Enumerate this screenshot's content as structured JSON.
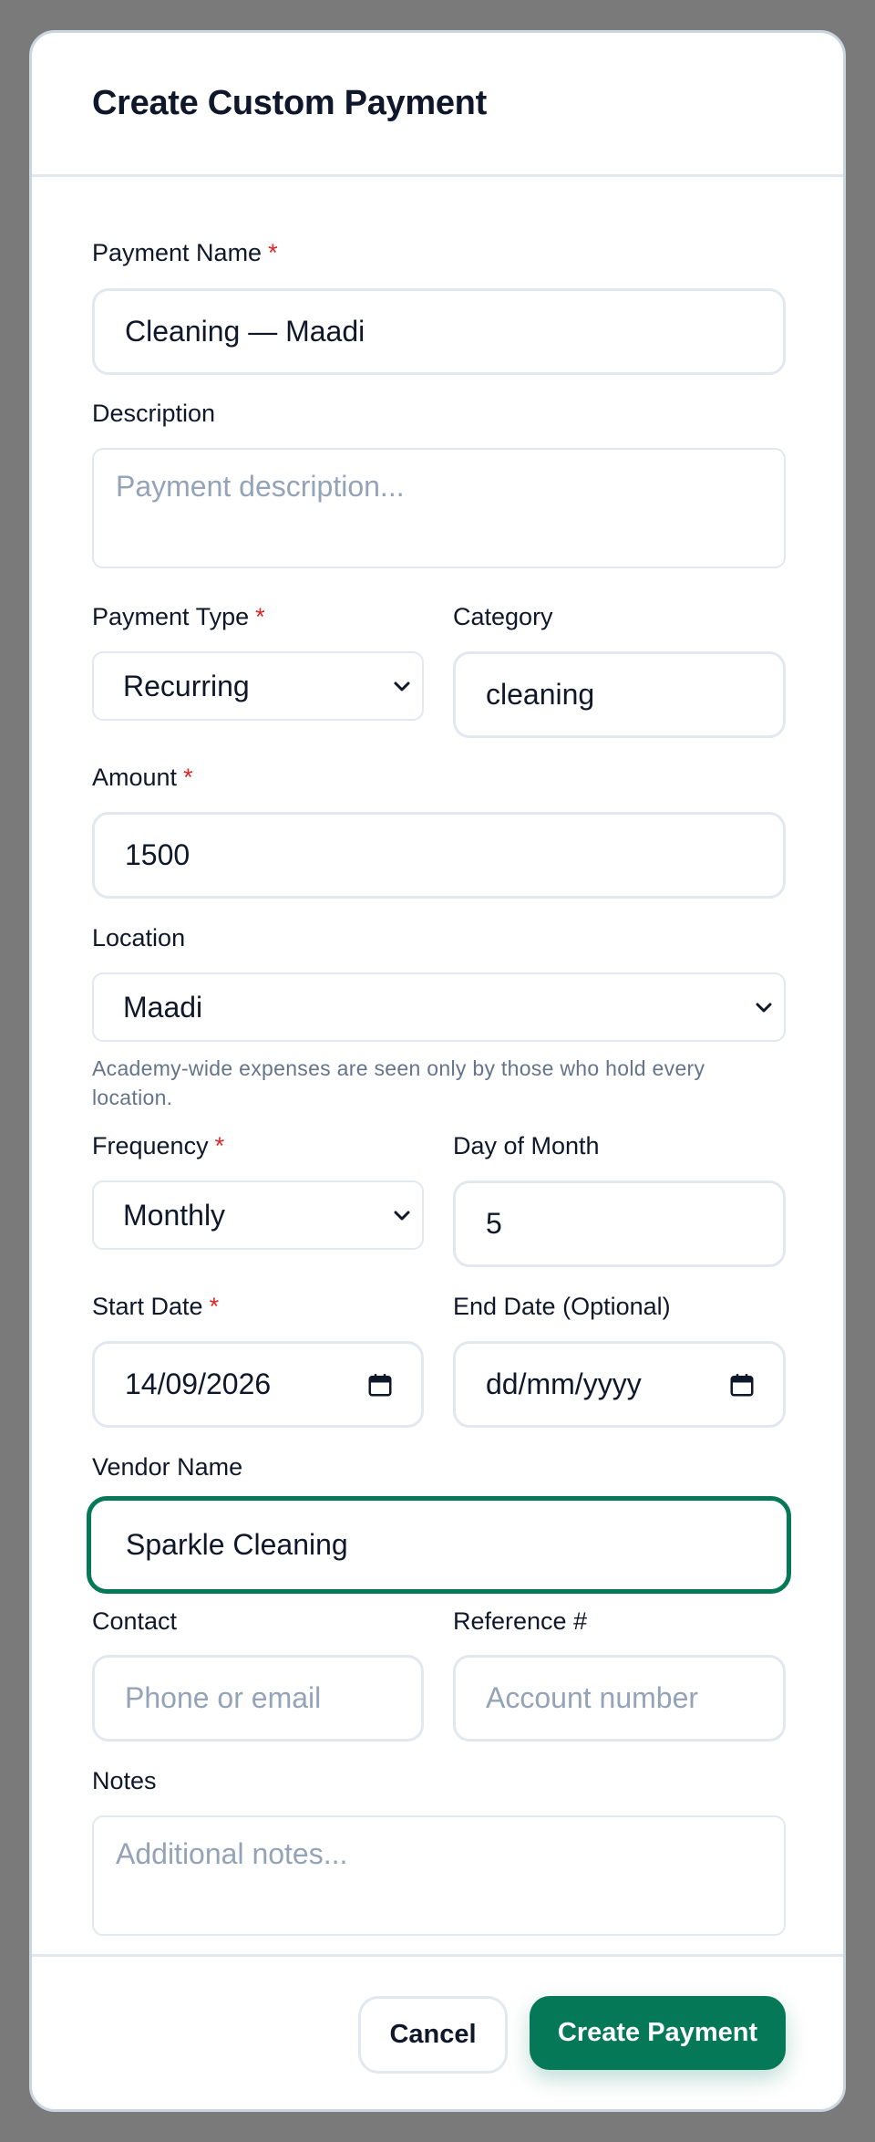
{
  "modal": {
    "title": "Create Custom Payment"
  },
  "form": {
    "required_mark": "*",
    "payment_name": {
      "label": "Payment Name",
      "value": "Cleaning — Maadi"
    },
    "description": {
      "label": "Description",
      "placeholder": "Payment description..."
    },
    "payment_type": {
      "label": "Payment Type",
      "value": "Recurring"
    },
    "category": {
      "label": "Category",
      "value": "cleaning"
    },
    "amount": {
      "label": "Amount",
      "value": "1500"
    },
    "location": {
      "label": "Location",
      "value": "Maadi",
      "helper": "Academy-wide expenses are seen only by those who hold every location."
    },
    "frequency": {
      "label": "Frequency",
      "value": "Monthly"
    },
    "day_of_month": {
      "label": "Day of Month",
      "value": "5"
    },
    "start_date": {
      "label": "Start Date",
      "value": "14/09/2026"
    },
    "end_date": {
      "label": "End Date (Optional)",
      "placeholder": "dd/mm/yyyy"
    },
    "vendor_name": {
      "label": "Vendor Name",
      "value": "Sparkle Cleaning"
    },
    "contact": {
      "label": "Contact",
      "placeholder": "Phone or email"
    },
    "reference": {
      "label": "Reference #",
      "placeholder": "Account number"
    },
    "notes": {
      "label": "Notes",
      "placeholder": "Additional notes..."
    }
  },
  "footer": {
    "cancel_label": "Cancel",
    "submit_label": "Create Payment"
  },
  "colors": {
    "accent": "#047857",
    "required": "#dc2626",
    "backdrop": "#7a7a7a"
  },
  "icons": {
    "select": "chevron-down-icon",
    "date": "calendar-icon"
  }
}
